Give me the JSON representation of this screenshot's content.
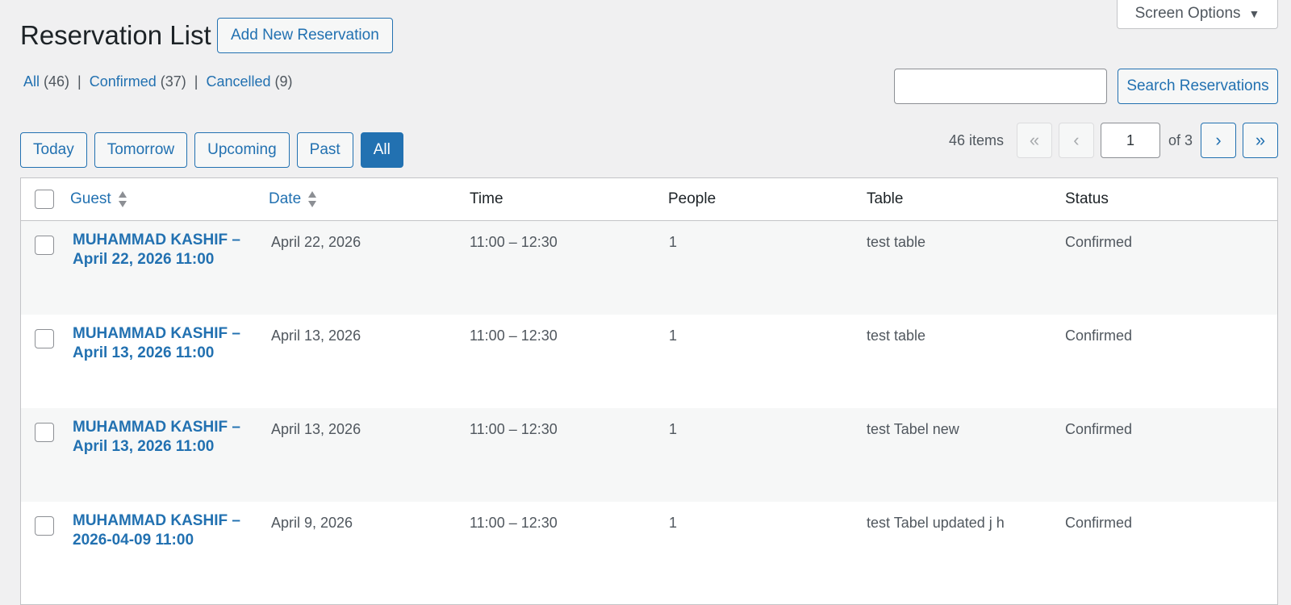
{
  "screen_options": {
    "label": "Screen Options",
    "arrow": "▼"
  },
  "header": {
    "title": "Reservation List",
    "add_new_label": "Add New Reservation"
  },
  "views": [
    {
      "label": "All",
      "count": "(46)"
    },
    {
      "label": "Confirmed",
      "count": "(37)"
    },
    {
      "label": "Cancelled",
      "count": "(9)"
    }
  ],
  "views_separator": "|",
  "search": {
    "value": "",
    "placeholder": "",
    "button_label": "Search Reservations"
  },
  "filters": [
    {
      "label": "Today",
      "active": false
    },
    {
      "label": "Tomorrow",
      "active": false
    },
    {
      "label": "Upcoming",
      "active": false
    },
    {
      "label": "Past",
      "active": false
    },
    {
      "label": "All",
      "active": true
    }
  ],
  "pagination": {
    "items_text": "46 items",
    "first": "«",
    "prev": "‹",
    "next": "›",
    "last": "»",
    "current_page": "1",
    "of_text": "of 3"
  },
  "table": {
    "columns": [
      "Guest",
      "Date",
      "Time",
      "People",
      "Table",
      "Status"
    ],
    "sort_icon": "sort-arrows-icon",
    "rows": [
      {
        "guest": "MUHAMMAD KASHIF – April 22, 2026 11:00",
        "date": "April 22, 2026",
        "time": "11:00 – 12:30",
        "people": "1",
        "table": "test table",
        "status": "Confirmed"
      },
      {
        "guest": "MUHAMMAD KASHIF – April 13, 2026 11:00",
        "date": "April 13, 2026",
        "time": "11:00 – 12:30",
        "people": "1",
        "table": "test table",
        "status": "Confirmed"
      },
      {
        "guest": "MUHAMMAD KASHIF – April 13, 2026 11:00",
        "date": "April 13, 2026",
        "time": "11:00 – 12:30",
        "people": "1",
        "table": "test Tabel new",
        "status": "Confirmed"
      },
      {
        "guest": "MUHAMMAD KASHIF – 2026-04-09 11:00",
        "date": "April 9, 2026",
        "time": "11:00 – 12:30",
        "people": "1",
        "table": "test Tabel updated j h",
        "status": "Confirmed"
      }
    ]
  },
  "colors": {
    "accent": "#2271b1",
    "background": "#f0f0f1"
  }
}
